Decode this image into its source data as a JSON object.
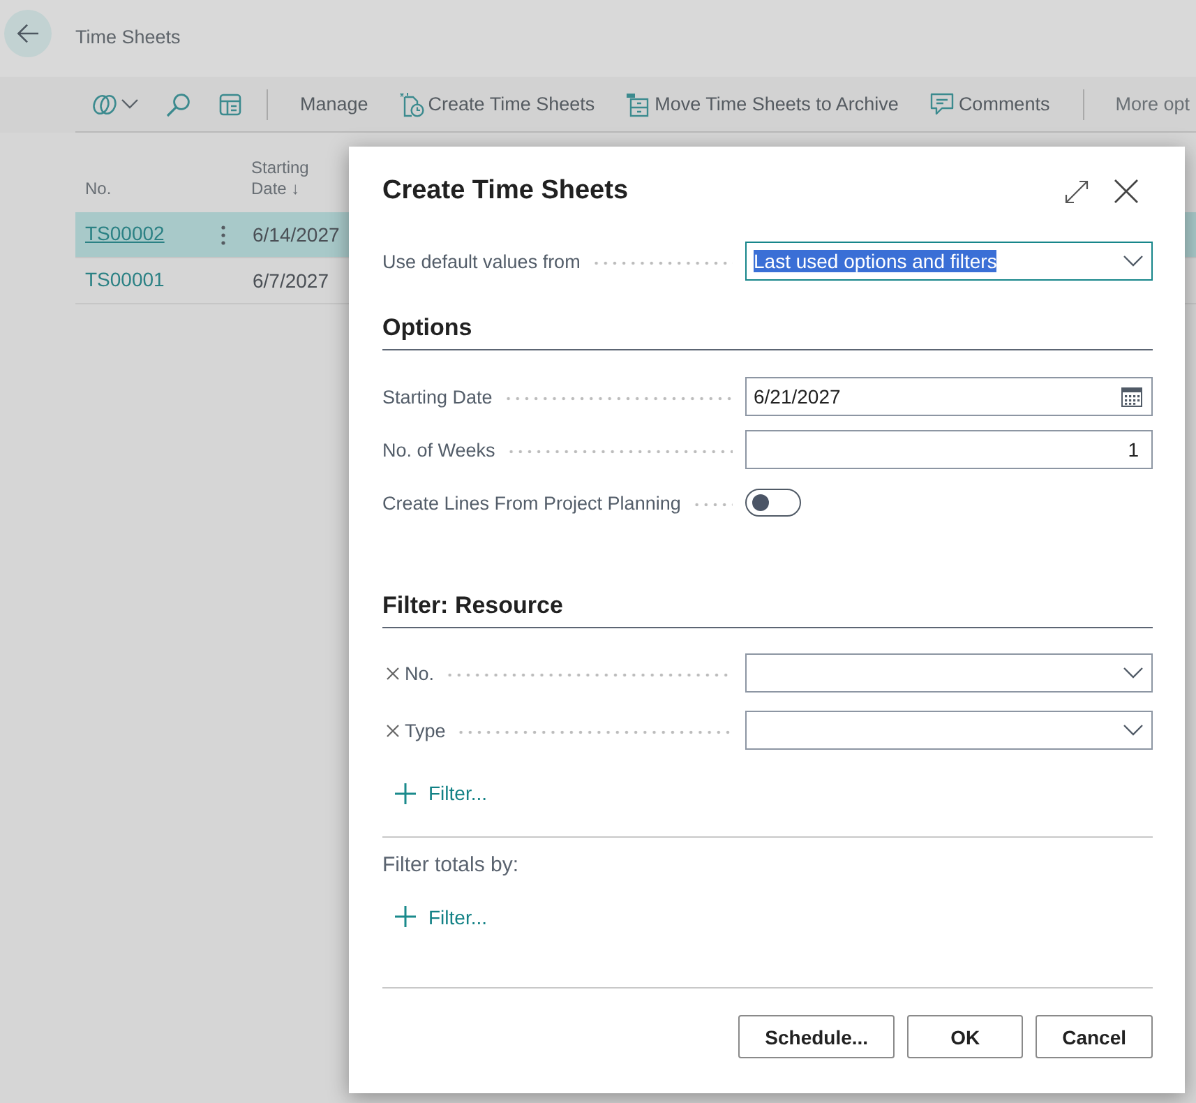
{
  "page": {
    "title": "Time Sheets"
  },
  "toolbar": {
    "actions": [
      {
        "label": "Manage"
      },
      {
        "label": "Create Time Sheets"
      },
      {
        "label": "Move Time Sheets to Archive"
      },
      {
        "label": "Comments"
      }
    ],
    "more": "More opt"
  },
  "list": {
    "columns": [
      {
        "label": "No."
      },
      {
        "label": "Starting Date",
        "sort_arrow": "↓"
      }
    ],
    "rows": [
      {
        "no": "TS00002",
        "starting_date": "6/14/2027",
        "selected": true
      },
      {
        "no": "TS00001",
        "starting_date": "6/7/2027",
        "selected": false
      }
    ]
  },
  "dialog": {
    "title": "Create Time Sheets",
    "default_values": {
      "label": "Use default values from",
      "value": "Last used options and filters",
      "focused": true
    },
    "sections": [
      {
        "title": "Options",
        "fields": [
          {
            "kind": "date",
            "label": "Starting Date",
            "value": "6/21/2027"
          },
          {
            "kind": "number",
            "label": "No. of Weeks",
            "value": "1"
          },
          {
            "kind": "toggle",
            "label": "Create Lines From Project Planning",
            "on": false
          }
        ]
      },
      {
        "title": "Filter: Resource",
        "fields": [
          {
            "kind": "filter-dropdown",
            "label": "No."
          },
          {
            "kind": "filter-dropdown",
            "label": "Type"
          }
        ],
        "add_filter": "Filter..."
      }
    ],
    "totals": {
      "label": "Filter totals by:",
      "add_filter": "Filter..."
    },
    "buttons": [
      {
        "label": "Schedule..."
      },
      {
        "label": "OK"
      },
      {
        "label": "Cancel"
      }
    ]
  }
}
